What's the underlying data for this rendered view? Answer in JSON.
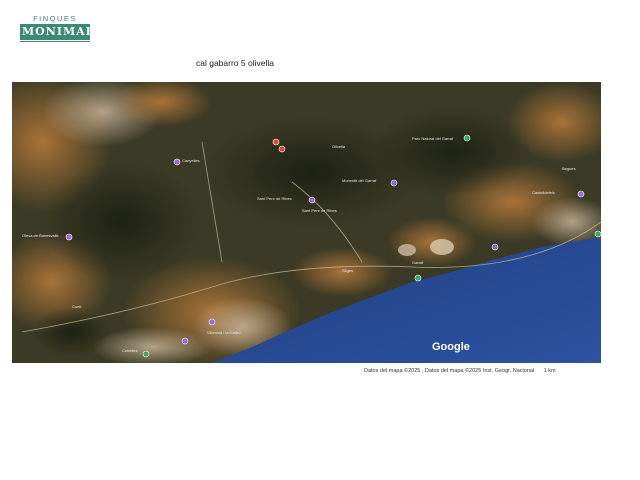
{
  "logo": {
    "top": "FINQUES",
    "main": "MONIMAR"
  },
  "caption": "cal gabarro 5 olivella",
  "map": {
    "brand": "Google",
    "attribution": "Datos del mapa ©2025 , Datos del mapa ©2025 Inst. Geogr. Nacional",
    "scale_label": "1 km",
    "labels": [
      "Cunit",
      "Cubelles",
      "Vilanova i la Geltrú",
      "Sant Pere de Ribes",
      "Olivella",
      "Canyelles",
      "Sitges",
      "Garraf",
      "Castelldefels",
      "Begues",
      "Olesa de Bonesvalls",
      "Sant Pere de Ribes",
      "Parc Natural del Garraf",
      "Monestir del Garraf"
    ],
    "colors": {
      "sea": "#25478c",
      "land_dark": "#2e3322",
      "land_light": "#a8763a",
      "urban": "#b9a58a"
    }
  }
}
